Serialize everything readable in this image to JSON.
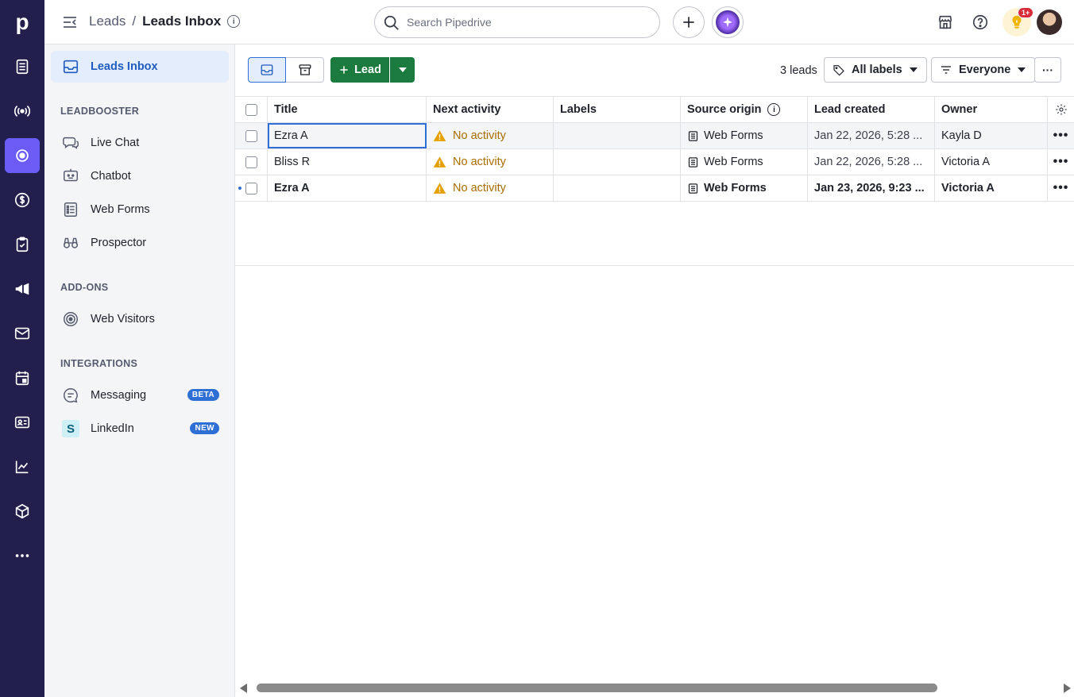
{
  "app": {
    "logo_letter": "p"
  },
  "rail": {
    "items": [
      "leads-icon",
      "activity-feed-icon",
      "leads-inbox-icon",
      "deals-icon",
      "tasks-icon",
      "campaigns-icon",
      "mail-icon",
      "calendar-icon",
      "contacts-icon",
      "insights-icon",
      "products-icon",
      "more-icon"
    ],
    "active": "leads-inbox-icon"
  },
  "header": {
    "crumb_parent": "Leads",
    "crumb_sep": "/",
    "crumb_current": "Leads Inbox",
    "search_placeholder": "Search Pipedrive",
    "notification_badge": "1+"
  },
  "sidebar": {
    "leads_inbox": "Leads Inbox",
    "leadbooster_heading": "LEADBOOSTER",
    "leadbooster_items": [
      "Live Chat",
      "Chatbot",
      "Web Forms",
      "Prospector"
    ],
    "addons_heading": "ADD-ONS",
    "addons_items": [
      "Web Visitors"
    ],
    "integrations_heading": "INTEGRATIONS",
    "messaging": "Messaging",
    "messaging_tag": "BETA",
    "linkedin": "LinkedIn",
    "linkedin_tag": "NEW"
  },
  "toolbar": {
    "lead_button": "Lead",
    "lead_count": "3 leads",
    "labels_filter": "All labels",
    "owner_filter": "Everyone",
    "more": "···"
  },
  "table": {
    "columns": [
      "Title",
      "Next activity",
      "Labels",
      "Source origin",
      "Lead created",
      "Owner"
    ],
    "rows": [
      {
        "title": "Ezra A",
        "next_activity": "No activity",
        "labels": "",
        "source": "Web Forms",
        "created": "Jan 22, 2026, 5:28 ...",
        "owner": "Kayla D"
      },
      {
        "title": "Bliss R",
        "next_activity": "No activity",
        "labels": "",
        "source": "Web Forms",
        "created": "Jan 22, 2026, 5:28 ...",
        "owner": "Victoria A"
      },
      {
        "title": "Ezra A",
        "next_activity": "No activity",
        "labels": "",
        "source": "Web Forms",
        "created": "Jan 23, 2026, 9:23 ...",
        "owner": "Victoria A"
      }
    ],
    "row_actions": "•••"
  }
}
